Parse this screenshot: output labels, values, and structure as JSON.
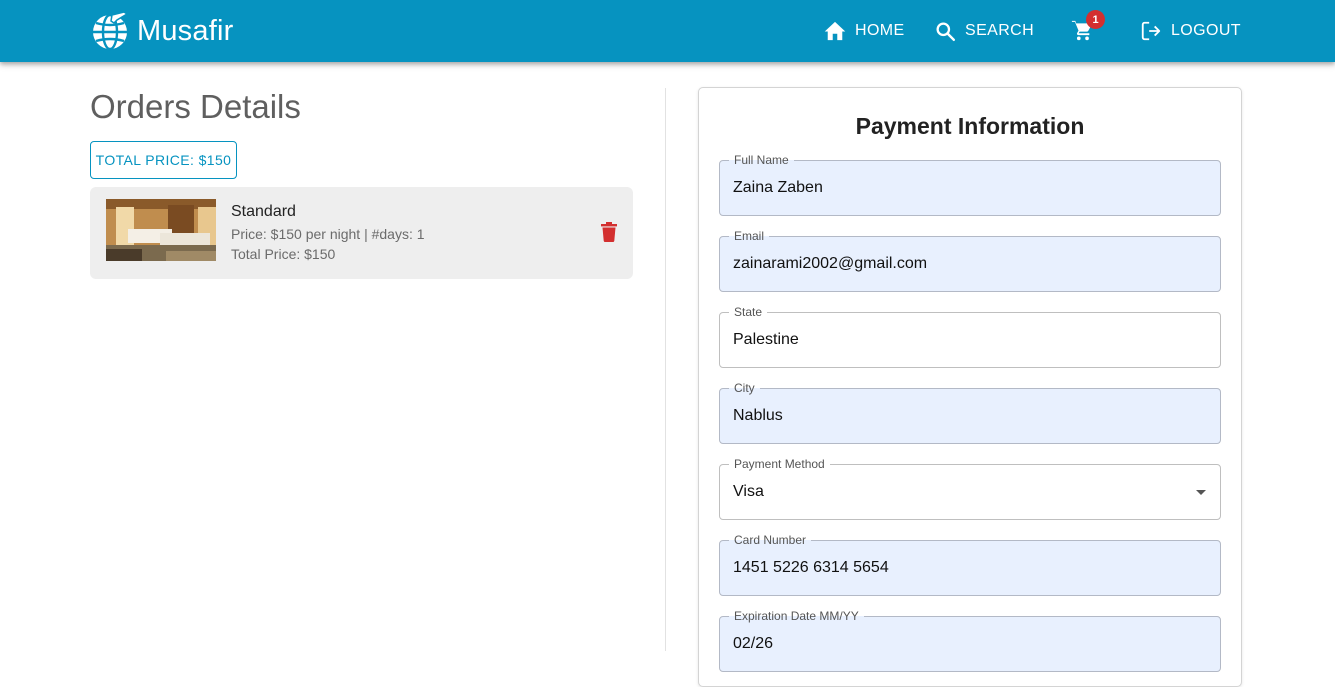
{
  "app": {
    "brand": "Musafir"
  },
  "nav": {
    "home_label": "HOME",
    "search_label": "SEARCH",
    "cart_count": "1",
    "logout_label": "LOGOUT"
  },
  "orders": {
    "title": "Orders Details",
    "total_button": "TOTAL PRICE: $150",
    "items": [
      {
        "name": "Standard",
        "price_line": "Price: $150 per night | #days: 1",
        "total_line": "Total Price: $150"
      }
    ]
  },
  "payment": {
    "title": "Payment Information",
    "fields": [
      {
        "label": "Full Name",
        "value": "Zaina Zaben"
      },
      {
        "label": "Email",
        "value": "zainarami2002@gmail.com"
      },
      {
        "label": "State",
        "value": "Palestine"
      },
      {
        "label": "City",
        "value": "Nablus"
      },
      {
        "label": "Payment Method",
        "value": "Visa"
      },
      {
        "label": "Card Number",
        "value": "1451 5226 6314 5654"
      },
      {
        "label": "Expiration Date MM/YY",
        "value": "02/26"
      }
    ]
  },
  "colors": {
    "primary": "#0693c0",
    "badge": "#d32f2f",
    "delete": "#d32f2f",
    "autofill": "#e8f0fe"
  }
}
